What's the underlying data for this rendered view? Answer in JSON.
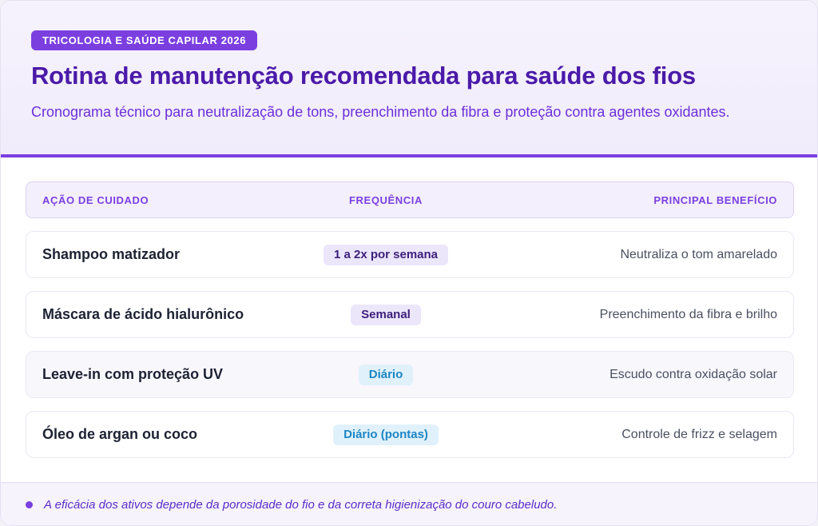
{
  "header": {
    "tag": "TRICOLOGIA E SAÚDE CAPILAR 2026",
    "title": "Rotina de manutenção recomendada para saúde dos fios",
    "subtitle": "Cronograma técnico para neutralização de tons, preenchimento da fibra e proteção contra agentes oxidantes."
  },
  "table": {
    "columns": [
      "AÇÃO DE CUIDADO",
      "FREQUÊNCIA",
      "PRINCIPAL BENEFÍCIO"
    ],
    "rows": [
      {
        "action": "Shampoo matizador",
        "frequency": "1 a 2x por semana",
        "benefit": "Neutraliza o tom amarelado",
        "pill_color": "purple"
      },
      {
        "action": "Máscara de ácido hialurônico",
        "frequency": "Semanal",
        "benefit": "Preenchimento da fibra e brilho",
        "pill_color": "purple"
      },
      {
        "action": "Leave-in com proteção UV",
        "frequency": "Diário",
        "benefit": "Escudo contra oxidação solar",
        "pill_color": "blue"
      },
      {
        "action": "Óleo de argan ou coco",
        "frequency": "Diário (pontas)",
        "benefit": "Controle de frizz e selagem",
        "pill_color": "blue"
      }
    ]
  },
  "footer": {
    "note": "A eficácia dos ativos depende da porosidade do fio e da correta higienização do couro cabeludo."
  },
  "colors": {
    "accent": "#7b3fe0",
    "title": "#4a1aa8",
    "pill_purple": "#ece6fb",
    "pill_blue": "#e0f1fb"
  }
}
